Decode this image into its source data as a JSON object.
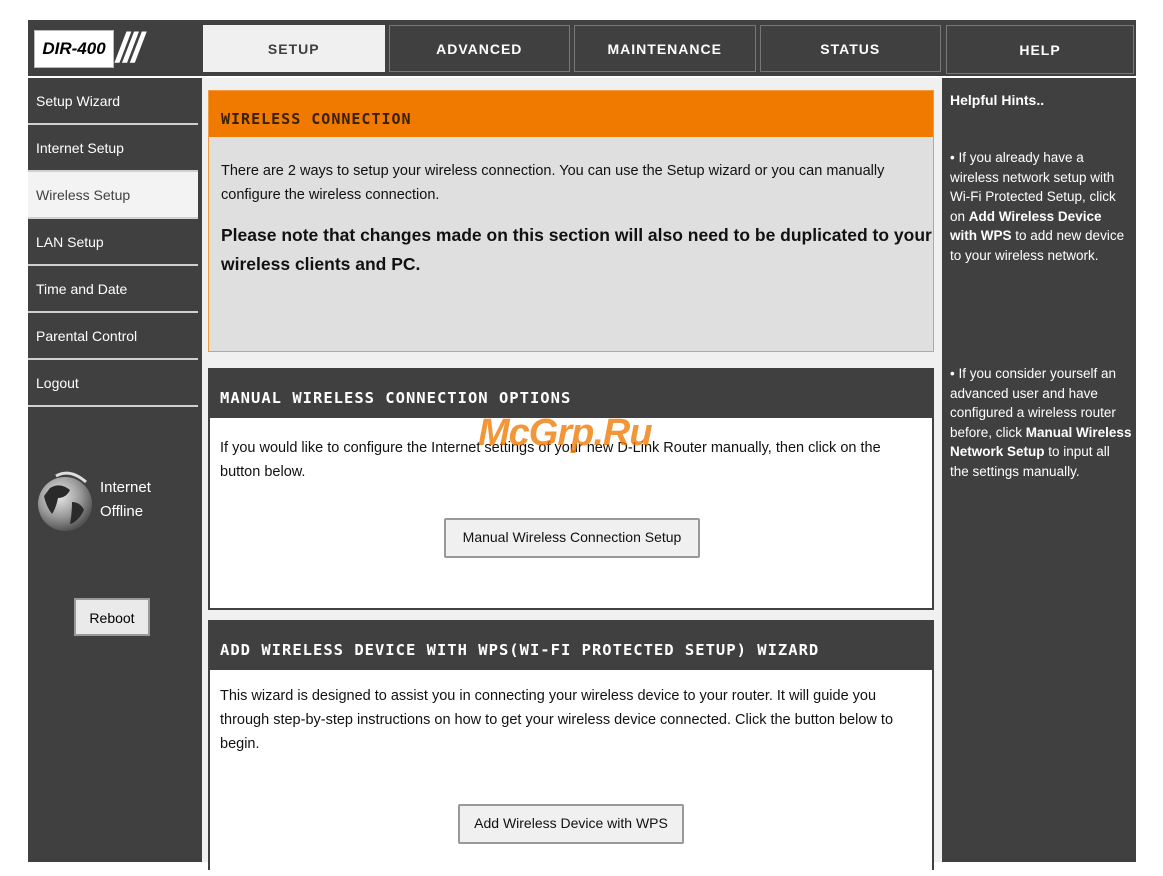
{
  "logo": {
    "model": "DIR-400"
  },
  "tabs": [
    {
      "label": "SETUP"
    },
    {
      "label": "ADVANCED"
    },
    {
      "label": "MAINTENANCE"
    },
    {
      "label": "STATUS"
    }
  ],
  "help_tab": {
    "label": "HELP"
  },
  "sidebar": {
    "items": [
      {
        "label": "Setup Wizard"
      },
      {
        "label": "Internet Setup"
      },
      {
        "label": "Wireless Setup"
      },
      {
        "label": "LAN Setup"
      },
      {
        "label": "Time and Date"
      },
      {
        "label": "Parental Control"
      },
      {
        "label": "Logout"
      }
    ],
    "status_line1": "Internet",
    "status_line2": "Offline",
    "reboot_label": "Reboot"
  },
  "wireless_connection": {
    "title": "WIRELESS CONNECTION",
    "intro": "There are 2 ways to setup your wireless connection. You can use the Setup wizard or you can manually configure the wireless connection.",
    "note": "Please note that changes made on this section will also need to be duplicated to your wireless clients and PC."
  },
  "manual_options": {
    "title": "MANUAL WIRELESS CONNECTION OPTIONS",
    "text": "If you would like to configure the Internet settings of your new D-Link Router manually, then click on the button below.",
    "button_label": "Manual Wireless Connection Setup"
  },
  "wps_wizard": {
    "title": "ADD WIRELESS DEVICE WITH WPS(WI-FI PROTECTED SETUP) WIZARD",
    "text": "This wizard is designed to assist you in connecting your wireless device to your router. It will guide you through step-by-step instructions on how to get your wireless device connected. Click the button below to begin.",
    "button_label": "Add Wireless Device with WPS"
  },
  "help": {
    "title": "Helpful Hints..",
    "hint1_pre": "• If you already have a wireless network setup with Wi-Fi Protected Setup, click on ",
    "hint1_bold": "Add Wireless Device with WPS",
    "hint1_post": " to add new device to your wireless network.",
    "hint2_pre": "• If you consider yourself an advanced user and have configured a wireless router before, click ",
    "hint2_bold": "Manual Wireless Network Setup",
    "hint2_post": " to input all the settings manually."
  },
  "watermark": "McGrp.Ru",
  "colors": {
    "accent": "#f07a00",
    "dark": "#404040"
  }
}
